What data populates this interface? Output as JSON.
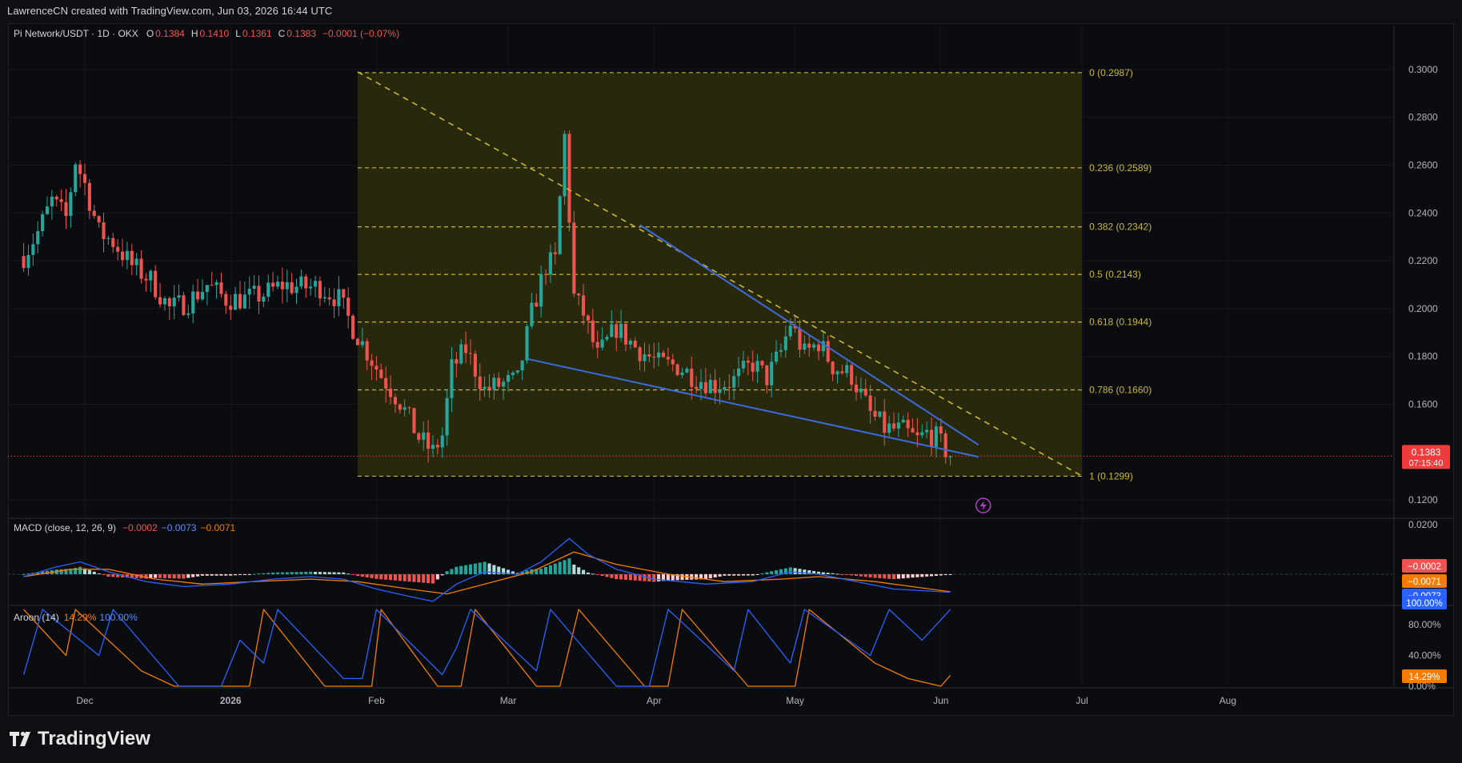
{
  "header": {
    "caption": "LawrenceCN created with TradingView.com, Jun 03, 2026 16:44 UTC"
  },
  "branding": {
    "logo_text": "TradingView",
    "logo_icon": "tradingview-logo-icon"
  },
  "colors": {
    "up": "#26a69a",
    "down": "#ef5350",
    "fib": "#c9b835",
    "fib_fill": "#2b2b0c",
    "wedge": "#3d6bdc",
    "macd_line": "#2962ff",
    "signal_line": "#f57c00",
    "aroon_up": "#2962ff",
    "aroon_down": "#f57c00",
    "price_badge": "#ef3b3b"
  },
  "chart_data": [
    {
      "type": "candlestick",
      "legend": {
        "symbol": "Pi Network/USDT · 1D · OKX",
        "o_label": "O",
        "o": "0.1384",
        "h_label": "H",
        "h": "0.1410",
        "l_label": "L",
        "l": "0.1361",
        "c_label": "C",
        "c": "0.1383",
        "change": "−0.0001 (−0.07%)"
      },
      "ylim": [
        0.115,
        0.305
      ],
      "y_ticks": [
        "0.3000",
        "0.2800",
        "0.2600",
        "0.2400",
        "0.2200",
        "0.2000",
        "0.1800",
        "0.1600",
        "0.1200"
      ],
      "x_ticks": [
        "Dec",
        "2026",
        "Feb",
        "Mar",
        "Apr",
        "May",
        "Jun",
        "Jul",
        "Aug"
      ],
      "last_price": {
        "value": "0.1383",
        "countdown": "07:15:40"
      },
      "close_path": [
        [
          "2025-11-18",
          0.222
        ],
        [
          "2025-11-21",
          0.232
        ],
        [
          "2025-11-24",
          0.245
        ],
        [
          "2025-11-27",
          0.238
        ],
        [
          "2025-11-29",
          0.262
        ],
        [
          "2025-12-01",
          0.252
        ],
        [
          "2025-12-04",
          0.232
        ],
        [
          "2025-12-07",
          0.228
        ],
        [
          "2025-12-11",
          0.218
        ],
        [
          "2025-12-15",
          0.212
        ],
        [
          "2025-12-19",
          0.2
        ],
        [
          "2025-12-23",
          0.203
        ],
        [
          "2025-12-27",
          0.21
        ],
        [
          "2025-12-31",
          0.204
        ],
        [
          "2026-01-04",
          0.204
        ],
        [
          "2026-01-08",
          0.206
        ],
        [
          "2026-01-12",
          0.21
        ],
        [
          "2026-01-16",
          0.209
        ],
        [
          "2026-01-20",
          0.209
        ],
        [
          "2026-01-24",
          0.204
        ],
        [
          "2026-01-27",
          0.192
        ],
        [
          "2026-01-30",
          0.182
        ],
        [
          "2026-02-02",
          0.172
        ],
        [
          "2026-02-06",
          0.161
        ],
        [
          "2026-02-10",
          0.146
        ],
        [
          "2026-02-13",
          0.14
        ],
        [
          "2026-02-15",
          0.147
        ],
        [
          "2026-02-17",
          0.175
        ],
        [
          "2026-02-20",
          0.183
        ],
        [
          "2026-02-24",
          0.166
        ],
        [
          "2026-02-27",
          0.168
        ],
        [
          "2026-03-03",
          0.17
        ],
        [
          "2026-03-06",
          0.198
        ],
        [
          "2026-03-09",
          0.218
        ],
        [
          "2026-03-11",
          0.22
        ],
        [
          "2026-03-13",
          0.272
        ],
        [
          "2026-03-15",
          0.205
        ],
        [
          "2026-03-17",
          0.198
        ],
        [
          "2026-03-20",
          0.18
        ],
        [
          "2026-03-24",
          0.192
        ],
        [
          "2026-03-28",
          0.184
        ],
        [
          "2026-04-02",
          0.177
        ],
        [
          "2026-04-06",
          0.176
        ],
        [
          "2026-04-10",
          0.171
        ],
        [
          "2026-04-14",
          0.168
        ],
        [
          "2026-04-18",
          0.17
        ],
        [
          "2026-04-22",
          0.177
        ],
        [
          "2026-04-25",
          0.171
        ],
        [
          "2026-04-28",
          0.182
        ],
        [
          "2026-04-30",
          0.194
        ],
        [
          "2026-05-03",
          0.181
        ],
        [
          "2026-05-06",
          0.186
        ],
        [
          "2026-05-09",
          0.176
        ],
        [
          "2026-05-13",
          0.172
        ],
        [
          "2026-05-17",
          0.156
        ],
        [
          "2026-05-20",
          0.15
        ],
        [
          "2026-05-24",
          0.149
        ],
        [
          "2026-05-27",
          0.145
        ],
        [
          "2026-05-29",
          0.148
        ],
        [
          "2026-05-31",
          0.146
        ],
        [
          "2026-06-03",
          0.1383
        ]
      ],
      "fibonacci": {
        "start": "2026-01-28",
        "end": "2026-07-01",
        "levels": [
          {
            "label": "0 (0.2987)",
            "value": 0.2987
          },
          {
            "label": "0.236 (0.2589)",
            "value": 0.2589
          },
          {
            "label": "0.382 (0.2342)",
            "value": 0.2342
          },
          {
            "label": "0.5 (0.2143)",
            "value": 0.2143
          },
          {
            "label": "0.618 (0.1944)",
            "value": 0.1944
          },
          {
            "label": "0.786 (0.1660)",
            "value": 0.166
          },
          {
            "label": "1 (0.1299)",
            "value": 0.1299
          }
        ]
      },
      "trend_dashed": [
        [
          "2026-01-28",
          0.299
        ],
        [
          "2026-07-01",
          0.13
        ]
      ],
      "wedge_upper": [
        [
          "2026-03-29",
          0.235
        ],
        [
          "2026-06-09",
          0.143
        ]
      ],
      "wedge_lower": [
        [
          "2026-03-05",
          0.179
        ],
        [
          "2026-06-09",
          0.138
        ]
      ],
      "alert_icon": "lightning-icon"
    },
    {
      "type": "line",
      "legend": {
        "name": "MACD (close, 12, 26, 9)",
        "hist": "−0.0002",
        "macd": "−0.0073",
        "signal": "−0.0071"
      },
      "ylim": [
        -0.012,
        0.022
      ],
      "y_ticks": [
        "0.0200"
      ],
      "badges": [
        "−0.0002",
        "−0.0071",
        "−0.0073"
      ],
      "macd_path": [
        [
          "2025-11-18",
          -0.001
        ],
        [
          "2025-11-25",
          0.003
        ],
        [
          "2025-11-30",
          0.005
        ],
        [
          "2025-12-06",
          0.001
        ],
        [
          "2025-12-14",
          -0.003
        ],
        [
          "2025-12-22",
          -0.005
        ],
        [
          "2026-01-01",
          -0.004
        ],
        [
          "2026-01-10",
          -0.002
        ],
        [
          "2026-01-18",
          -0.001
        ],
        [
          "2026-01-25",
          -0.002
        ],
        [
          "2026-02-01",
          -0.006
        ],
        [
          "2026-02-08",
          -0.009
        ],
        [
          "2026-02-13",
          -0.011
        ],
        [
          "2026-02-18",
          -0.004
        ],
        [
          "2026-02-24",
          0.001
        ],
        [
          "2026-03-03",
          0.0
        ],
        [
          "2026-03-08",
          0.005
        ],
        [
          "2026-03-14",
          0.0145
        ],
        [
          "2026-03-18",
          0.008
        ],
        [
          "2026-03-24",
          0.002
        ],
        [
          "2026-04-01",
          -0.002
        ],
        [
          "2026-04-12",
          -0.004
        ],
        [
          "2026-04-22",
          -0.003
        ],
        [
          "2026-04-30",
          0.001
        ],
        [
          "2026-05-06",
          0.0
        ],
        [
          "2026-05-14",
          -0.003
        ],
        [
          "2026-05-22",
          -0.006
        ],
        [
          "2026-06-03",
          -0.0073
        ]
      ],
      "signal_path": [
        [
          "2025-11-18",
          -0.001
        ],
        [
          "2025-11-28",
          0.002
        ],
        [
          "2025-12-06",
          0.002
        ],
        [
          "2025-12-16",
          -0.002
        ],
        [
          "2025-12-26",
          -0.004
        ],
        [
          "2026-01-06",
          -0.003
        ],
        [
          "2026-01-18",
          -0.002
        ],
        [
          "2026-01-28",
          -0.003
        ],
        [
          "2026-02-08",
          -0.006
        ],
        [
          "2026-02-16",
          -0.008
        ],
        [
          "2026-02-26",
          -0.003
        ],
        [
          "2026-03-06",
          0.001
        ],
        [
          "2026-03-15",
          0.009
        ],
        [
          "2026-03-24",
          0.004
        ],
        [
          "2026-04-04",
          0.0
        ],
        [
          "2026-04-16",
          -0.003
        ],
        [
          "2026-04-28",
          -0.002
        ],
        [
          "2026-05-06",
          -0.001
        ],
        [
          "2026-05-18",
          -0.003
        ],
        [
          "2026-06-03",
          -0.0071
        ]
      ]
    },
    {
      "type": "line",
      "legend": {
        "name": "Aroon (14)",
        "down": "14.29%",
        "up": "100.00%"
      },
      "ylim": [
        0,
        100
      ],
      "y_ticks": [
        "80.00%",
        "40.00%",
        "0.00%"
      ],
      "badges": [
        "100.00%",
        "14.29%"
      ],
      "up_path": [
        [
          "2025-11-18",
          15
        ],
        [
          "2025-11-22",
          100
        ],
        [
          "2025-12-04",
          40
        ],
        [
          "2025-12-07",
          100
        ],
        [
          "2025-12-21",
          0
        ],
        [
          "2025-12-30",
          0
        ],
        [
          "2026-01-03",
          60
        ],
        [
          "2026-01-08",
          30
        ],
        [
          "2026-01-11",
          100
        ],
        [
          "2026-01-25",
          10
        ],
        [
          "2026-01-29",
          10
        ],
        [
          "2026-02-01",
          100
        ],
        [
          "2026-02-15",
          15
        ],
        [
          "2026-02-18",
          50
        ],
        [
          "2026-02-21",
          100
        ],
        [
          "2026-03-07",
          20
        ],
        [
          "2026-03-10",
          100
        ],
        [
          "2026-03-24",
          0
        ],
        [
          "2026-03-31",
          0
        ],
        [
          "2026-04-04",
          100
        ],
        [
          "2026-04-18",
          20
        ],
        [
          "2026-04-21",
          100
        ],
        [
          "2026-04-30",
          30
        ],
        [
          "2026-05-03",
          100
        ],
        [
          "2026-05-17",
          40
        ],
        [
          "2026-05-21",
          100
        ],
        [
          "2026-05-28",
          60
        ],
        [
          "2026-06-03",
          100
        ]
      ],
      "down_path": [
        [
          "2025-11-18",
          100
        ],
        [
          "2025-11-27",
          40
        ],
        [
          "2025-11-29",
          100
        ],
        [
          "2025-12-13",
          20
        ],
        [
          "2025-12-20",
          0
        ],
        [
          "2026-01-05",
          0
        ],
        [
          "2026-01-08",
          100
        ],
        [
          "2026-01-21",
          0
        ],
        [
          "2026-01-31",
          0
        ],
        [
          "2026-02-02",
          100
        ],
        [
          "2026-02-14",
          0
        ],
        [
          "2026-02-19",
          0
        ],
        [
          "2026-02-22",
          100
        ],
        [
          "2026-03-07",
          0
        ],
        [
          "2026-03-12",
          0
        ],
        [
          "2026-03-16",
          100
        ],
        [
          "2026-03-30",
          0
        ],
        [
          "2026-04-04",
          0
        ],
        [
          "2026-04-07",
          100
        ],
        [
          "2026-04-21",
          0
        ],
        [
          "2026-05-01",
          0
        ],
        [
          "2026-05-04",
          100
        ],
        [
          "2026-05-18",
          30
        ],
        [
          "2026-05-25",
          10
        ],
        [
          "2026-06-01",
          0
        ],
        [
          "2026-06-03",
          14.29
        ]
      ]
    }
  ]
}
